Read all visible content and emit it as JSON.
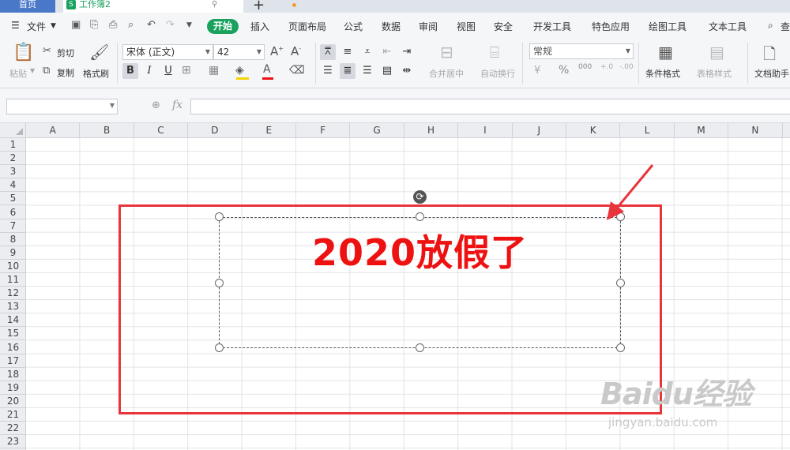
{
  "tabs": {
    "home": "首页",
    "document": "工作簿2",
    "doc_icon": "S",
    "pin_icon": "pin-icon",
    "add": "+"
  },
  "menu": {
    "file": "文件",
    "start": "开始",
    "items": [
      "插入",
      "页面布局",
      "公式",
      "数据",
      "审阅",
      "视图",
      "安全",
      "开发工具",
      "特色应用",
      "绘图工具",
      "文本工具"
    ],
    "search": "查"
  },
  "ribbon": {
    "paste": "粘贴",
    "cut": "剪切",
    "copy": "复制",
    "format_painter": "格式刷",
    "font_name": "宋体 (正文)",
    "font_size": "42",
    "bold": "B",
    "italic": "I",
    "underline": "U",
    "merge_center": "合并居中",
    "wrap_text": "自动换行",
    "number_format": "常规",
    "percent": "%",
    "thousands": "000",
    "conditional_format": "条件格式",
    "table_style": "表格样式",
    "doc_helper": "文档助手"
  },
  "formula_bar": {
    "name_box": "",
    "fx": "fx",
    "formula": ""
  },
  "grid": {
    "columns": [
      "A",
      "B",
      "C",
      "D",
      "E",
      "F",
      "G",
      "H",
      "I",
      "J",
      "K",
      "L",
      "M",
      "N"
    ],
    "rows": [
      "1",
      "2",
      "3",
      "4",
      "5",
      "6",
      "7",
      "8",
      "9",
      "10",
      "11",
      "12",
      "13",
      "14",
      "15",
      "16",
      "17",
      "18",
      "19",
      "20",
      "21",
      "22",
      "23"
    ]
  },
  "textbox": {
    "text": "2020放假了",
    "color": "#ee1111"
  },
  "annotation": {
    "frame_color": "#e8353c"
  },
  "watermark": {
    "brand": "Baidu经验",
    "url": "jingyan.baidu.com"
  },
  "colors": {
    "accent": "#1aa15e",
    "home_tab": "#4a78c8"
  }
}
